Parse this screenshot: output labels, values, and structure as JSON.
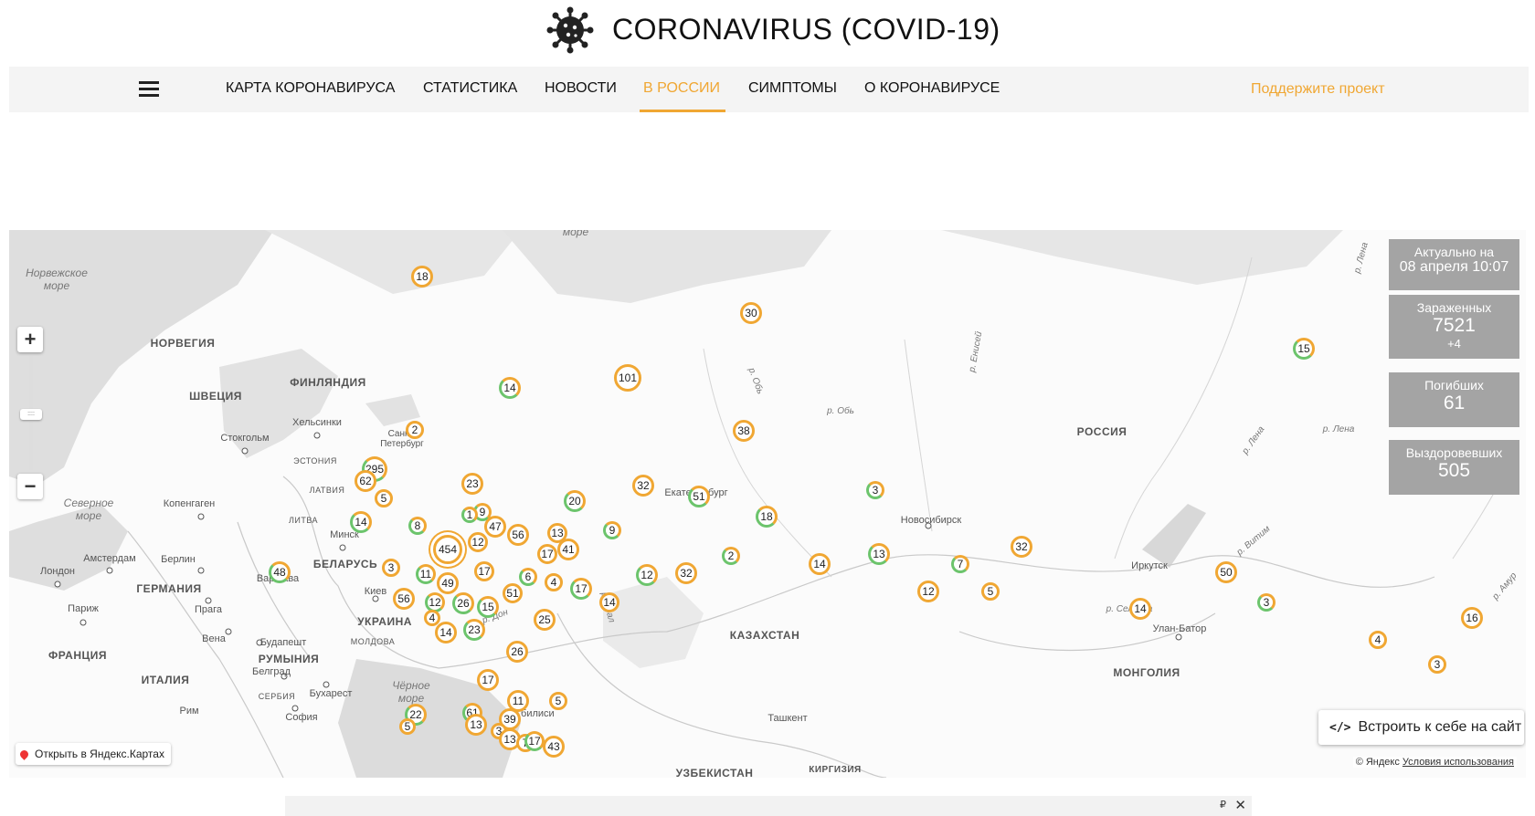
{
  "header": {
    "title": "CORONAVIRUS (COVID-19)"
  },
  "nav": {
    "items": [
      {
        "label": "КАРТА КОРОНАВИРУСА",
        "active": false
      },
      {
        "label": "СТАТИСТИКА",
        "active": false
      },
      {
        "label": "НОВОСТИ",
        "active": false
      },
      {
        "label": "В РОССИИ",
        "active": true
      },
      {
        "label": "СИМПТОМЫ",
        "active": false
      },
      {
        "label": "О КОРОНАВИРУСЕ",
        "active": false
      }
    ],
    "support": "Поддержите проект",
    "menu_icon": "hamburger-icon"
  },
  "stats": {
    "updated_label": "Актуально на",
    "updated_value": "08 апреля 10:07",
    "infected_label": "Зараженных",
    "infected_value": "7521",
    "infected_delta": "+4",
    "dead_label": "Погибших",
    "dead_value": "61",
    "recovered_label": "Выздоровевших",
    "recovered_value": "505"
  },
  "map": {
    "zoom_in": "+",
    "zoom_out": "−",
    "open_link": "Открыть в Яндекс.Картах",
    "embed_icon": "</>",
    "embed": "Встроить к себе на сайт",
    "copyright": "© Яндекс",
    "terms": "Условия использования",
    "countries": [
      "НОРВЕГИЯ",
      "ФИНЛЯНДИЯ",
      "ШВЕЦИЯ",
      "ЭСТОНИЯ",
      "ЛАТВИЯ",
      "ЛИТВА",
      "BELARUS",
      "ГЕРМАНИЯ",
      "УКРАИНА",
      "ФРАНЦИЯ",
      "ИТАЛИЯ",
      "РУМЫНИЯ",
      "СЕРБИЯ",
      "МОЛДОВА",
      "РОССИЯ",
      "КАЗАХСТАН",
      "МОНГОЛИЯ",
      "УЗБЕКИСТАН",
      "КИРГИЗИЯ"
    ],
    "country_labels": {
      "norway": "НОРВЕГИЯ",
      "finland": "ФИНЛЯНДИЯ",
      "sweden": "ШВЕЦИЯ",
      "estonia": "ЭСТОНИЯ",
      "latvia": "ЛАТВИЯ",
      "lithuania": "ЛИТВА",
      "belarus": "БЕЛАРУСЬ",
      "germany": "ГЕРМАНИЯ",
      "ukraine": "УКРАИНА",
      "france": "ФРАНЦИЯ",
      "italy": "ИТАЛИЯ",
      "romania": "РУМЫНИЯ",
      "serbia": "СЕРБИЯ",
      "moldova": "МОЛДОВА",
      "russia": "РОССИЯ",
      "kazakhstan": "КАЗАХСТАН",
      "mongolia": "МОНГОЛИЯ",
      "uzbekistan": "УЗБЕКИСТАН",
      "kyrgyzstan": "КИРГИЗИЯ"
    },
    "cities": {
      "helsinki": "Хельсинки",
      "stockholm": "Стокгольм",
      "spb": "Санкт-Петербург",
      "copenhagen": "Копенгаген",
      "minsk": "Минск",
      "amsterdam": "Амстердам",
      "berlin": "Берлин",
      "warsaw": "Варшава",
      "london": "Лондон",
      "paris": "Париж",
      "prague": "Прага",
      "kiev": "Киев",
      "vienna": "Вена",
      "budapest": "Будапешт",
      "belgrade": "Белград",
      "bucharest": "Бухарест",
      "rome": "Рим",
      "sofia": "София",
      "ekaterinburg": "Екатеринбург",
      "novosibirsk": "Новосибирск",
      "irkutsk": "Иркутск",
      "ulanbator": "Улан-Батор",
      "tashkent": "Ташкент",
      "tbilisi": "Тбилиси"
    },
    "seas": {
      "norwegian_1": "Норвежское",
      "norwegian_2": "море",
      "north_1": "Северное",
      "north_2": "море",
      "black_1": "Чёрное",
      "black_2": "море",
      "top": "море"
    },
    "rivers": {
      "ob1": "р. Обь",
      "ob2": "р. Обь",
      "yenisei": "р. Енисей",
      "lena1": "р. Лена",
      "lena2": "р. Лена",
      "lena3": "р. Лена",
      "vitim": "р. Витим",
      "amur": "р. Амур",
      "ural": "р. Урал",
      "don": "р. Дон",
      "selenga": "р. Селенга"
    },
    "markers": [
      "18",
      "30",
      "15",
      "14",
      "101",
      "2",
      "38",
      "295",
      "62",
      "5",
      "23",
      "32",
      "51",
      "18",
      "3",
      "9",
      "1",
      "47",
      "56",
      "20",
      "13",
      "14",
      "8",
      "454",
      "12",
      "41",
      "17",
      "9",
      "48",
      "3",
      "17",
      "6",
      "4",
      "17",
      "12",
      "32",
      "2",
      "14",
      "13",
      "7",
      "32",
      "11",
      "49",
      "51",
      "14",
      "12",
      "56",
      "12",
      "26",
      "15",
      "25",
      "5",
      "50",
      "14",
      "3",
      "16",
      "4",
      "4",
      "14",
      "23",
      "26",
      "3",
      "17",
      "11",
      "5",
      "22",
      "61",
      "13",
      "39",
      "5",
      "3",
      "13",
      "7",
      "17",
      "43"
    ]
  },
  "ad": {
    "currency": "₽",
    "close": "✕"
  }
}
